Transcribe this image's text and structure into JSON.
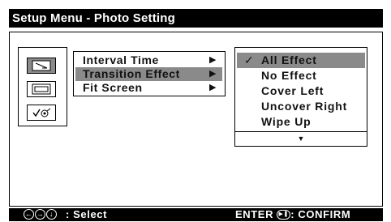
{
  "title": "Setup Menu - Photo Setting",
  "menu": {
    "items": [
      {
        "label": "Interval Time",
        "arrow": "▶",
        "selected": false
      },
      {
        "label": "Transition Effect",
        "arrow": "▶",
        "selected": true
      },
      {
        "label": "Fit Screen",
        "arrow": "▶",
        "selected": false
      }
    ]
  },
  "options": {
    "check": "✓",
    "items": [
      {
        "label": "All Effect",
        "selected": true
      },
      {
        "label": "No Effect",
        "selected": false
      },
      {
        "label": "Cover Left",
        "selected": false
      },
      {
        "label": "Uncover Right",
        "selected": false
      },
      {
        "label": "Wipe Up",
        "selected": false
      }
    ],
    "more_arrow": "▼"
  },
  "footer": {
    "nav_icons": [
      "←",
      "→",
      "↓"
    ],
    "select_label": ": Select",
    "enter_label": "ENTER",
    "confirm_label": ": CONFIRM"
  },
  "colors": {
    "highlight": "#8a8a8a",
    "bar": "#000000"
  }
}
